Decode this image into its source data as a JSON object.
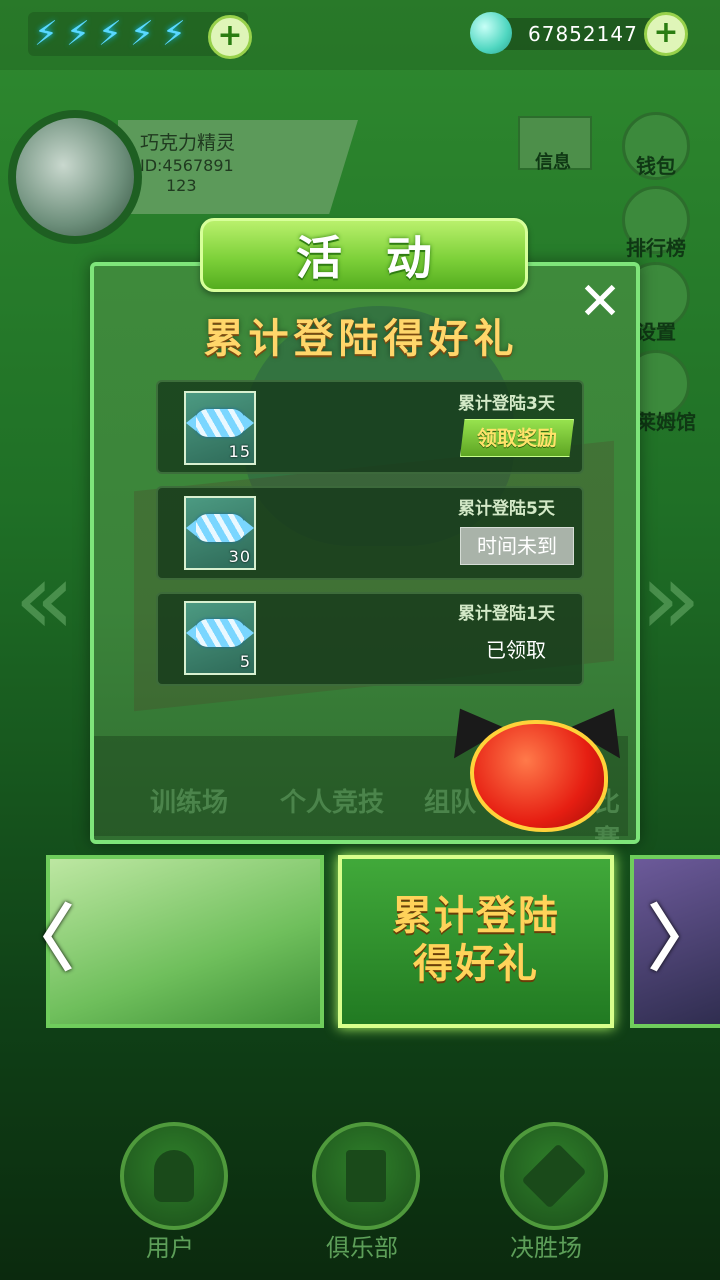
{
  "topbar": {
    "energy_icons": [
      "lightning-icon",
      "lightning-icon",
      "lightning-icon",
      "lightning-icon",
      "lightning-icon"
    ],
    "add_energy_symbol": "+",
    "coin_amount": "67852147",
    "add_coin_symbol": "+"
  },
  "profile": {
    "name": "巧克力精灵",
    "id_text": "ID:4567891",
    "level": "123"
  },
  "side_menu": {
    "mail": "信息",
    "wallet": "钱包",
    "ranking": "排行榜",
    "settings": "设置",
    "slime_hall": "史莱姆馆"
  },
  "modal": {
    "tab_title": "活动",
    "close_symbol": "✕",
    "subtitle": "累计登陆得好礼",
    "rows": [
      {
        "condition": "累计登陆3天",
        "count": "15",
        "action": "领取奖励",
        "state": "claimable"
      },
      {
        "condition": "累计登陆5天",
        "count": "30",
        "action": "时间未到",
        "state": "locked"
      },
      {
        "condition": "累计登陆1天",
        "count": "5",
        "action": "已领取",
        "state": "claimed"
      }
    ],
    "bg_strip": [
      "训练场",
      "个人竞技",
      "组队",
      "比赛"
    ]
  },
  "carousel": {
    "left_arrow": "〈",
    "right_arrow": "〉",
    "center_banner_line1": "累计登陆",
    "center_banner_line2": "得好礼"
  },
  "bottom_nav": {
    "user": "用户",
    "club": "俱乐部",
    "battle": "决胜场"
  },
  "colors": {
    "accent_green": "#7ed13a",
    "gold_text": "#ffd66a",
    "modal_border": "#7ee57a"
  }
}
